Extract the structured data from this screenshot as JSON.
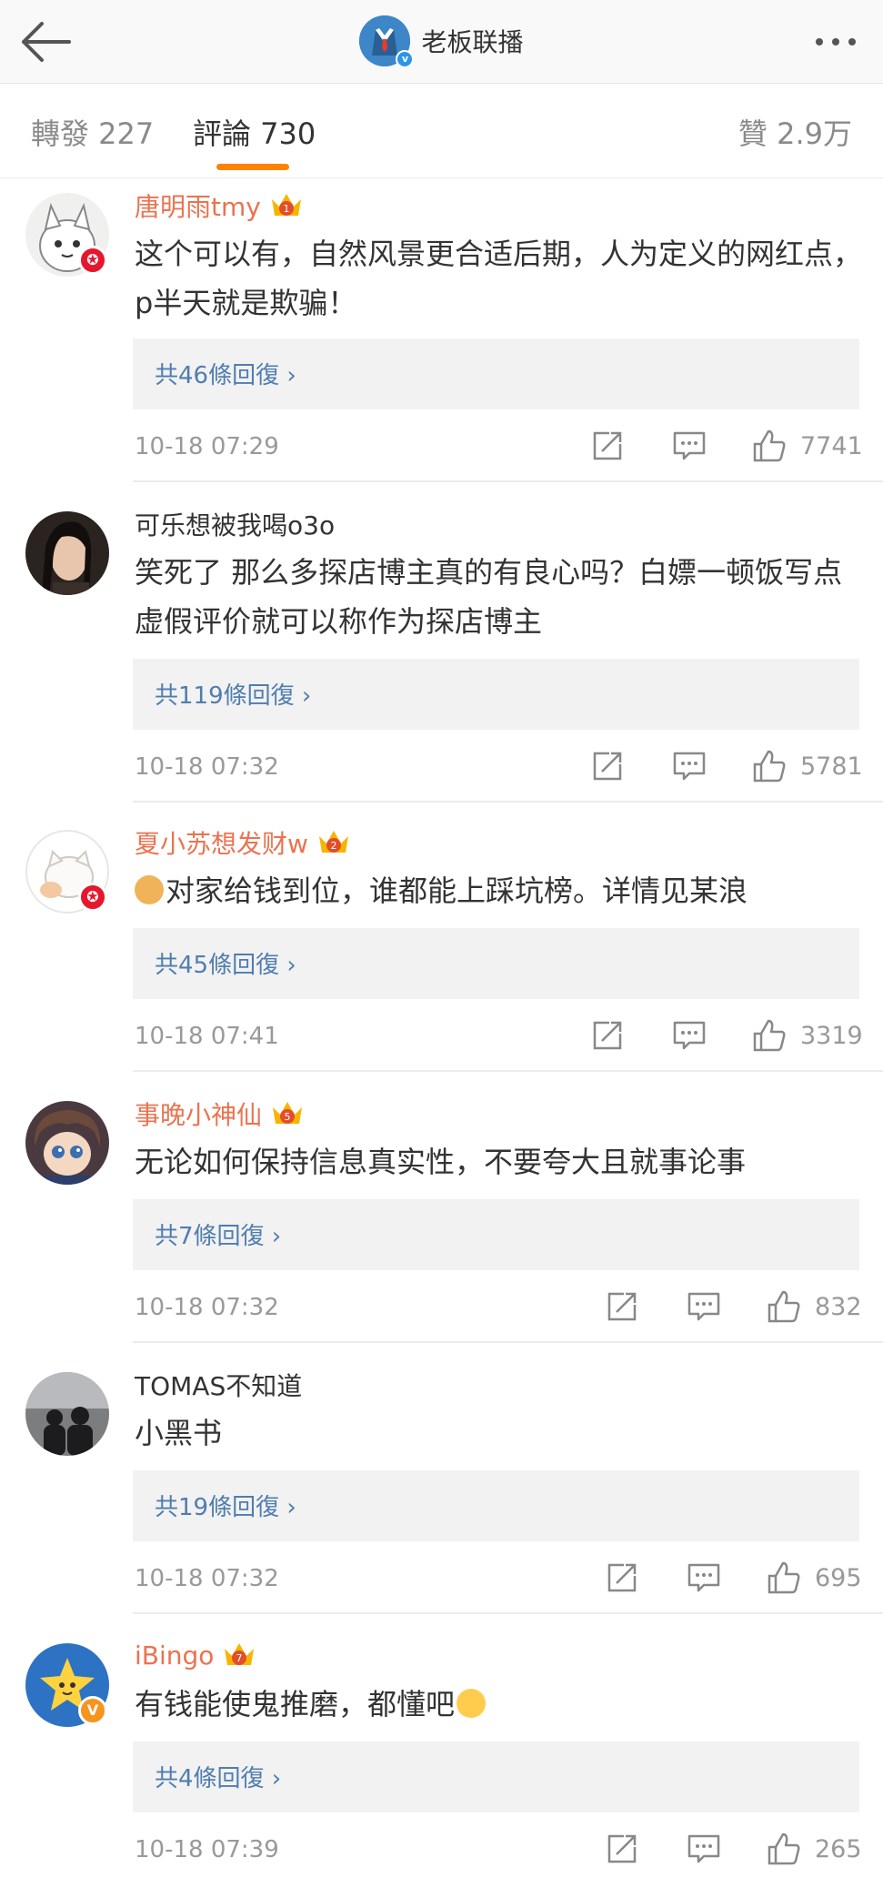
{
  "header": {
    "title": "老板联播",
    "back_icon": "back-arrow-icon",
    "more_icon": "more-dots-icon"
  },
  "tabs": [
    {
      "label": "轉發 227"
    },
    {
      "label": "評論 730"
    },
    {
      "label": "贊 2.9万"
    }
  ],
  "colors": {
    "accent": "#ff8200",
    "vip_name": "#eb7350",
    "link": "#507daf"
  },
  "comments": [
    {
      "user": "唐明雨tmy",
      "crown_level": "1",
      "text": "这个可以有，自然风景更合适后期，人为定义的网红点，p半天就是欺骗！",
      "replies": "共46條回復 ›",
      "time": "10-18 07:29",
      "likes": "7741"
    },
    {
      "user": "可乐想被我喝o3o",
      "text": "笑死了 那么多探店博主真的有良心吗？白嫖一顿饭写点虚假评价就可以称作为探店博主",
      "replies": "共119條回復 ›",
      "time": "10-18 07:32",
      "likes": "5781"
    },
    {
      "user": "夏小苏想发财w",
      "crown_level": "2",
      "text": "对家给钱到位，谁都能上踩坑榜。详情见某浪",
      "replies": "共45條回復 ›",
      "time": "10-18 07:41",
      "likes": "3319"
    },
    {
      "user": "事晚小神仙",
      "crown_level": "5",
      "text": "无论如何保持信息真实性，不要夸大且就事论事",
      "replies": "共7條回復 ›",
      "time": "10-18 07:32",
      "likes": "832"
    },
    {
      "user": "TOMAS不知道",
      "text": "小黑书",
      "replies": "共19條回復 ›",
      "time": "10-18 07:32",
      "likes": "695"
    },
    {
      "user": "iBingo",
      "crown_level": "7",
      "text": "有钱能使鬼推磨，都懂吧",
      "replies": "共4條回復 ›",
      "time": "10-18 07:39",
      "likes": "265"
    }
  ]
}
